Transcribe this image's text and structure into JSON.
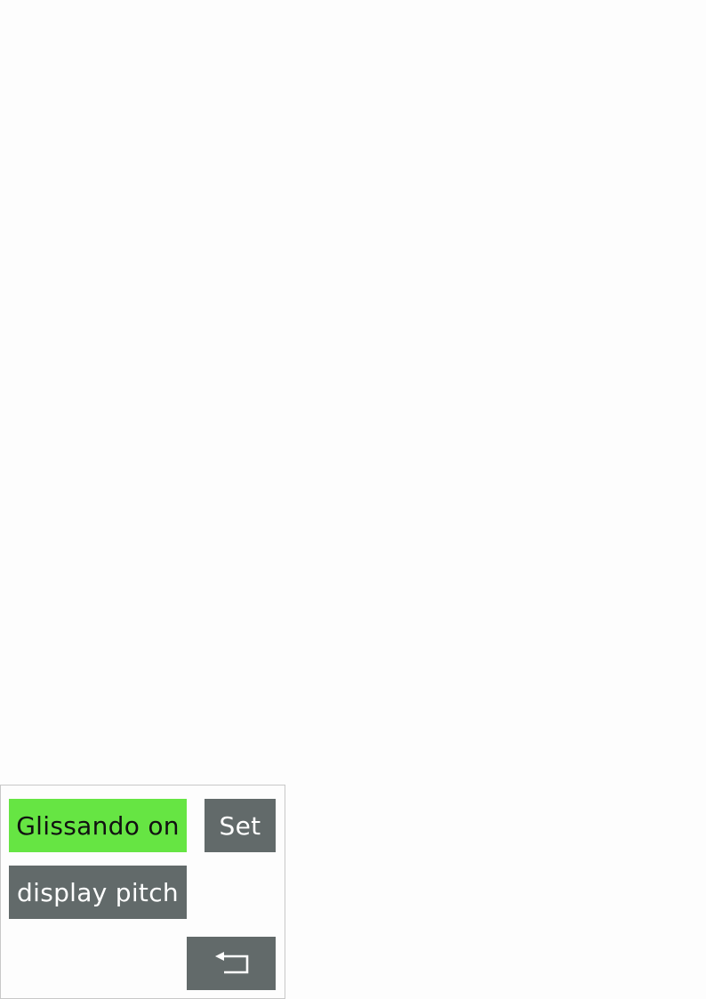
{
  "controls": {
    "glissando": {
      "label": "Glissando on",
      "color": "#66e543"
    },
    "set": {
      "label": "Set",
      "color": "#626a6a"
    },
    "pitch": {
      "label": "display pitch",
      "color": "#626a6a"
    },
    "back": {
      "icon": "return-arrow-icon",
      "color": "#626a6a"
    }
  }
}
